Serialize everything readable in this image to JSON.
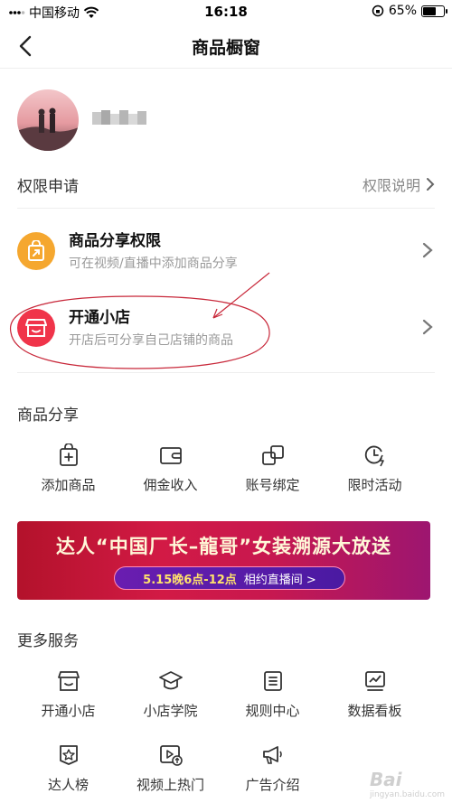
{
  "status_bar": {
    "carrier": "中国移动",
    "time": "16:18",
    "battery": "65%",
    "battery_level": 0.65
  },
  "navbar": {
    "title": "商品橱窗"
  },
  "permissions": {
    "section_title": "权限申请",
    "link_label": "权限说明",
    "items": [
      {
        "title": "商品分享权限",
        "desc": "可在视频/直播中添加商品分享",
        "color": "#f5a72f"
      },
      {
        "title": "开通小店",
        "desc": "开店后可分享自己店铺的商品",
        "color": "#f0344a"
      }
    ]
  },
  "goods_share": {
    "section_title": "商品分享",
    "items": [
      {
        "label": "添加商品",
        "icon": "add-goods-icon"
      },
      {
        "label": "佣金收入",
        "icon": "wallet-icon"
      },
      {
        "label": "账号绑定",
        "icon": "link-icon"
      },
      {
        "label": "限时活动",
        "icon": "clock-bolt-icon"
      }
    ]
  },
  "banner": {
    "headline": "达人“中国厂长–龍哥”女装溯源大放送",
    "time_text": "5.15晚6点-12点",
    "cta": "相约直播间 >"
  },
  "more_services": {
    "section_title": "更多服务",
    "items": [
      {
        "label": "开通小店",
        "icon": "store-icon"
      },
      {
        "label": "小店学院",
        "icon": "graduation-cap-icon"
      },
      {
        "label": "规则中心",
        "icon": "document-icon"
      },
      {
        "label": "数据看板",
        "icon": "chart-icon"
      },
      {
        "label": "达人榜",
        "icon": "star-badge-icon"
      },
      {
        "label": "视频上热门",
        "icon": "video-up-icon"
      },
      {
        "label": "广告介绍",
        "icon": "megaphone-icon"
      }
    ]
  },
  "watermark": {
    "text": "Bai",
    "sub": "jingyan.baidu.com"
  }
}
